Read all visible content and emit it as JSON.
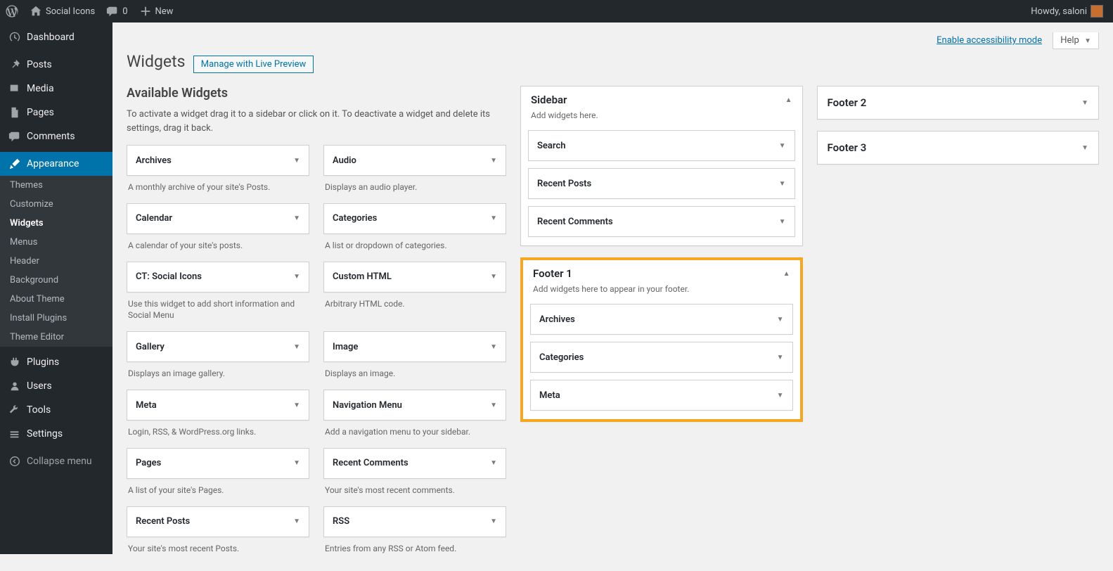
{
  "adminbar": {
    "site_title": "Social Icons",
    "comments_count": "0",
    "new_label": "New",
    "greeting": "Howdy, saloni"
  },
  "menu": {
    "dashboard": "Dashboard",
    "posts": "Posts",
    "media": "Media",
    "pages": "Pages",
    "comments": "Comments",
    "appearance": "Appearance",
    "appearance_sub": {
      "themes": "Themes",
      "customize": "Customize",
      "widgets": "Widgets",
      "menus": "Menus",
      "header": "Header",
      "background": "Background",
      "about_theme": "About Theme",
      "install_plugins": "Install Plugins",
      "theme_editor": "Theme Editor"
    },
    "plugins": "Plugins",
    "users": "Users",
    "tools": "Tools",
    "settings": "Settings",
    "collapse": "Collapse menu"
  },
  "top_links": {
    "accessibility": "Enable accessibility mode",
    "help": "Help"
  },
  "page": {
    "title": "Widgets",
    "live_preview_btn": "Manage with Live Preview"
  },
  "available": {
    "heading": "Available Widgets",
    "description": "To activate a widget drag it to a sidebar or click on it. To deactivate a widget and delete its settings, drag it back.",
    "widgets": [
      {
        "title": "Archives",
        "desc": "A monthly archive of your site's Posts."
      },
      {
        "title": "Audio",
        "desc": "Displays an audio player."
      },
      {
        "title": "Calendar",
        "desc": "A calendar of your site's posts."
      },
      {
        "title": "Categories",
        "desc": "A list or dropdown of categories."
      },
      {
        "title": "CT: Social Icons",
        "desc": "Use this widget to add short information and Social Menu"
      },
      {
        "title": "Custom HTML",
        "desc": "Arbitrary HTML code."
      },
      {
        "title": "Gallery",
        "desc": "Displays an image gallery."
      },
      {
        "title": "Image",
        "desc": "Displays an image."
      },
      {
        "title": "Meta",
        "desc": "Login, RSS, & WordPress.org links."
      },
      {
        "title": "Navigation Menu",
        "desc": "Add a navigation menu to your sidebar."
      },
      {
        "title": "Pages",
        "desc": "A list of your site's Pages."
      },
      {
        "title": "Recent Comments",
        "desc": "Your site's most recent comments."
      },
      {
        "title": "Recent Posts",
        "desc": "Your site's most recent Posts."
      },
      {
        "title": "RSS",
        "desc": "Entries from any RSS or Atom feed."
      }
    ]
  },
  "sidebars": {
    "sidebar": {
      "title": "Sidebar",
      "desc": "Add widgets here.",
      "items": [
        "Search",
        "Recent Posts",
        "Recent Comments"
      ]
    },
    "footer1": {
      "title": "Footer 1",
      "desc": "Add widgets here to appear in your footer.",
      "items": [
        "Archives",
        "Categories",
        "Meta"
      ]
    },
    "footer2": {
      "title": "Footer 2"
    },
    "footer3": {
      "title": "Footer 3"
    }
  }
}
